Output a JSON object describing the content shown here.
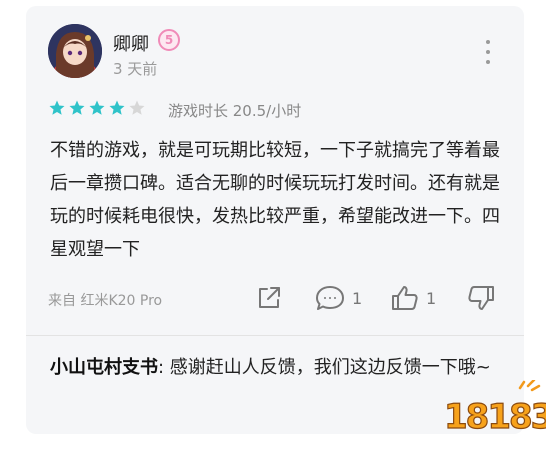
{
  "user": {
    "name": "卿卿",
    "level_badge": "5",
    "time": "3 天前"
  },
  "rating": {
    "stars": 4,
    "max": 5
  },
  "playtime": "游戏时长 20.5/小时",
  "review_text": "不错的游戏，就是可玩期比较短，一下子就搞完了等着最后一章攒口碑。适合无聊的时候玩玩打发时间。还有就是玩的时候耗电很快，发热比较严重，希望能改进一下。四星观望一下",
  "device": "来自 红米K20 Pro",
  "actions": {
    "comment_count": "1",
    "like_count": "1"
  },
  "reply": {
    "author": "小山屯村支书",
    "separator": ":",
    "text": " 感谢赶山人反馈，我们这边反馈一下哦~"
  },
  "watermark": "18183",
  "colors": {
    "star_on": "#2fc3c9",
    "star_off": "#d7d7d7",
    "badge": "#f08bb8"
  }
}
